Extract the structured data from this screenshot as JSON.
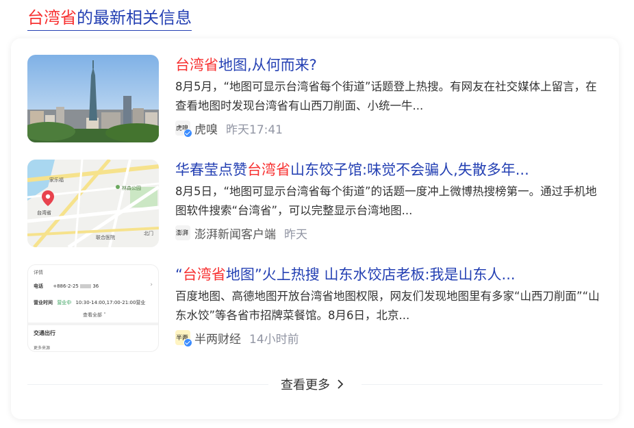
{
  "header": {
    "highlight": "台湾省",
    "rest": "的最新相关信息"
  },
  "items": [
    {
      "title_parts": [
        "",
        "台湾省",
        "地图,从何而来?"
      ],
      "desc": "8月5月，“地图可显示台湾省每个街道”话题登上热搜。有网友在社交媒体上留言，在查看地图时发现台湾省有山西刀削面、小统一牛...",
      "source": "虎嗅",
      "source_logo_text": "虎嗅",
      "time": "昨天17:41"
    },
    {
      "title_parts": [
        "华春莹点赞",
        "台湾省",
        "山东饺子馆:味觉不会骗人,失散多年..."
      ],
      "desc": "8月5日，“地图可显示台湾省每个街道”的话题一度冲上微博热搜榜第一。通过手机地图软件搜索“台湾省”，可以完整显示台湾地图...",
      "source": "澎湃新闻客户端",
      "source_logo_text": "澎湃",
      "time": "昨天",
      "map_labels": {
        "market": "家乐福",
        "park": "林森公园",
        "place": "台湾省",
        "bus": "北门",
        "hospital": "联合医院"
      }
    },
    {
      "title_parts": [
        "“",
        "台湾省",
        "地图”火上热搜 山东水饺店老板:我是山东人..."
      ],
      "desc": "百度地图、高德地图开放台湾省地图权限，网友们发现地图里有多家“山西刀削面”“山东水饺”等各省市招牌菜餐馆。8月6日，北京...",
      "source": "半两财经",
      "source_logo_text": "半两",
      "time": "14小时前",
      "thumb_texts": {
        "details": "详情",
        "phone_label": "电话",
        "phone_value": "+886-2-25",
        "phone_tail": "36",
        "hours_label": "营业时间",
        "hours_status": "营业中",
        "hours_value": "10:30-14:00,17:00-21:00营业",
        "view_all": "查看全部",
        "transport": "交通出行",
        "more": "更多来源"
      }
    }
  ],
  "more_label": "查看更多",
  "colors": {
    "link": "#2440b3",
    "highlight": "#f73131",
    "time": "#9195a3"
  }
}
